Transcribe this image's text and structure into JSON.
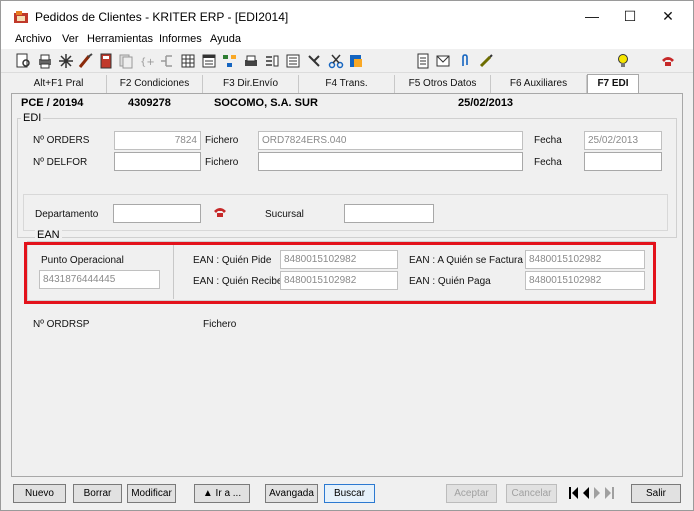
{
  "window": {
    "title": "Pedidos de Clientes - KRITER ERP - [EDI2014]"
  },
  "menu": [
    "Archivo",
    "Ver",
    "Herramientas",
    "Informes",
    "Ayuda"
  ],
  "toolbar_icons": [
    "print-preview-icon",
    "print-icon",
    "star-icon",
    "brush-icon",
    "book-icon",
    "copy-icon",
    "flow-icon",
    "hierarchy-icon",
    "grid-icon",
    "calendar-icon",
    "hierarchy2-icon",
    "printer-icon",
    "phone-icon",
    "list-icon",
    "tools-icon",
    "scissors-icon",
    "export-icon",
    "document-icon",
    "mail-icon",
    "paperclip-icon",
    "pencil-icon",
    "lightbulb-icon",
    "phone-red-icon"
  ],
  "tabs": [
    {
      "label": "Alt+F1 Pral"
    },
    {
      "label": "F2 Condiciones"
    },
    {
      "label": "F3 Dir.Envío"
    },
    {
      "label": "F4 Trans."
    },
    {
      "label": "F5 Otros Datos"
    },
    {
      "label": "F6 Auxiliares"
    },
    {
      "label": "F7 EDI"
    }
  ],
  "header": {
    "order": "PCE / 20194",
    "code": "4309278",
    "customer": "SOCOMO, S.A. SUR",
    "date": "25/02/2013"
  },
  "edi": {
    "legend": "EDI",
    "orders_label": "Nº ORDERS",
    "orders_value": "7824",
    "fichero_label": "Fichero",
    "fichero_value": "ORD7824ERS.040",
    "fecha_label": "Fecha",
    "fecha_value": "25/02/2013",
    "delfor_label": "Nº DELFOR",
    "delfor_fichero_label": "Fichero",
    "delfor_fecha_label": "Fecha",
    "departamento_label": "Departamento",
    "sucursal_label": "Sucursal"
  },
  "ean": {
    "legend": "EAN",
    "punto_label": "Punto Operacional",
    "punto_value": "8431876444445",
    "quien_pide_label": "EAN : Quién Pide",
    "quien_pide_value": "8480015102982",
    "quien_recibe_label": "EAN : Quién Recibe",
    "quien_recibe_value": "8480015102982",
    "quien_factura_label": "EAN : A Quién se Factura",
    "quien_factura_value": "8480015102982",
    "quien_paga_label": "EAN : Quién Paga",
    "quien_paga_value": "8480015102982"
  },
  "ordrsp": {
    "label": "Nº ORDRSP",
    "fichero_label": "Fichero"
  },
  "buttons": {
    "nuevo": "Nuevo",
    "borrar": "Borrar",
    "modificar": "Modificar",
    "ir_a": "▲ Ir a ...",
    "avanzada": "Avangada",
    "buscar": "Buscar",
    "aceptar": "Aceptar",
    "cancelar": "Cancelar",
    "salir": "Salir"
  },
  "colors": {
    "highlight": "#e3121b",
    "focus": "#2b79d1"
  }
}
